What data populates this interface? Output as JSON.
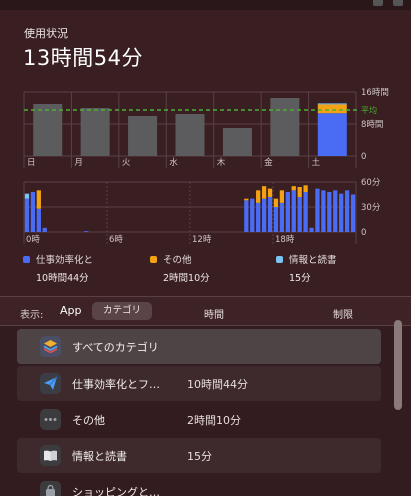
{
  "header": {
    "label": "使用状況",
    "total": "13時間54分"
  },
  "colors": {
    "productivity": "#4a6cf5",
    "other": "#f3a214",
    "info": "#79c4f0",
    "bar_gray": "#5c5c5e",
    "average_line": "#4caf32",
    "grid": "#5a4146"
  },
  "weekly_chart": {
    "type": "bar",
    "categories": [
      "日",
      "月",
      "火",
      "水",
      "木",
      "金",
      "土"
    ],
    "series": [
      {
        "name": "仕事効率化と",
        "values": [
          0,
          0,
          0,
          0,
          0,
          0,
          10.7
        ]
      },
      {
        "name": "その他",
        "values": [
          0,
          0,
          0,
          0,
          0,
          0,
          2.2
        ]
      },
      {
        "name": "情報と読書",
        "values": [
          0,
          0,
          0,
          0,
          0,
          0,
          0.25
        ]
      }
    ],
    "previous_totals": [
      13,
      12,
      10,
      10.5,
      7,
      14.5,
      0
    ],
    "average": 11.5,
    "average_label": "平均",
    "y_ticks": [
      "16時間",
      "8時間",
      "0"
    ],
    "y_max": 16
  },
  "hourly_chart": {
    "type": "bar",
    "x_ticks": [
      "0時",
      "6時",
      "12時",
      "18時"
    ],
    "y_ticks": [
      "60分",
      "30分",
      "0"
    ],
    "y_max": 60,
    "hours_productivity": [
      40,
      48,
      28,
      5,
      0,
      0,
      0,
      0,
      0,
      0,
      1,
      0,
      0,
      0,
      0,
      0,
      0,
      0,
      0,
      0,
      0,
      0,
      0,
      0,
      0,
      0,
      0,
      0,
      0,
      0,
      0,
      0,
      0,
      0,
      0,
      0,
      0,
      38,
      40,
      35,
      40,
      42,
      30,
      35,
      48,
      50,
      42,
      48,
      5,
      52,
      50,
      48,
      50,
      46,
      50,
      45
    ],
    "hours_other": [
      0,
      0,
      22,
      0,
      0,
      0,
      0,
      0,
      0,
      0,
      0,
      0,
      0,
      0,
      0,
      0,
      0,
      0,
      0,
      0,
      0,
      0,
      0,
      0,
      0,
      0,
      0,
      0,
      0,
      0,
      0,
      0,
      0,
      0,
      0,
      0,
      0,
      2,
      0,
      15,
      15,
      10,
      10,
      15,
      0,
      5,
      12,
      8,
      0,
      0,
      0,
      0,
      0,
      0,
      0,
      0
    ],
    "hours_info": [
      6,
      0,
      0,
      0,
      0,
      0,
      0,
      0,
      0,
      0,
      0,
      0,
      0,
      0,
      0,
      0,
      0,
      0,
      0,
      0,
      0,
      0,
      0,
      0,
      0,
      0,
      0,
      0,
      0,
      0,
      0,
      0,
      0,
      0,
      0,
      0,
      0,
      0,
      0,
      0,
      0,
      0,
      0,
      0,
      0,
      0,
      0,
      0,
      0,
      0,
      0,
      0,
      0,
      0,
      0,
      0
    ]
  },
  "legend": [
    {
      "name": "仕事効率化と",
      "value": "10時間44分",
      "color": "#4a6cf5"
    },
    {
      "name": "その他",
      "value": "2時間10分",
      "color": "#f3a214"
    },
    {
      "name": "情報と読書",
      "value": "15分",
      "color": "#79c4f0"
    }
  ],
  "toolbar": {
    "show_label": "表示:",
    "app_label": "App",
    "category_label": "カテゴリ",
    "time_label": "時間",
    "limit_label": "制限"
  },
  "list": [
    {
      "name": "すべてのカテゴリ",
      "time": "",
      "icon": "layers-icon",
      "icon_color": "#4a4f66"
    },
    {
      "name": "仕事効率化とフ…",
      "time": "10時間44分",
      "icon": "paper-plane-icon",
      "icon_color": "#3c3c44"
    },
    {
      "name": "その他",
      "time": "2時間10分",
      "icon": "ellipsis-icon",
      "icon_color": "#3c3c3e"
    },
    {
      "name": "情報と読書",
      "time": "15分",
      "icon": "book-icon",
      "icon_color": "#3c3c3e"
    },
    {
      "name": "ショッピングと…",
      "time": "",
      "icon": "bag-icon",
      "icon_color": "#3c3c3e"
    }
  ]
}
